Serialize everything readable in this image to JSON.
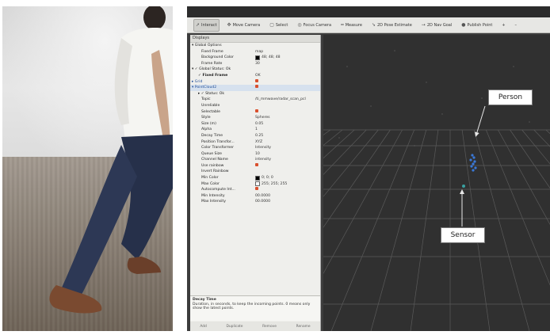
{
  "toolbar": {
    "items": [
      {
        "label": "Interact",
        "icon": "cursor-icon"
      },
      {
        "label": "Move Camera",
        "icon": "move-camera-icon"
      },
      {
        "label": "Select",
        "icon": "select-icon"
      },
      {
        "label": "Focus Camera",
        "icon": "focus-camera-icon"
      },
      {
        "label": "Measure",
        "icon": "ruler-icon"
      },
      {
        "label": "2D Pose Estimate",
        "icon": "arrow-icon"
      },
      {
        "label": "2D Nav Goal",
        "icon": "goal-icon"
      },
      {
        "label": "Publish Point",
        "icon": "pin-icon"
      },
      {
        "label": "+",
        "icon": "plus-icon"
      },
      {
        "label": "–",
        "icon": "minus-icon"
      }
    ]
  },
  "displays": {
    "header": "Displays",
    "rows": [
      {
        "key": "Global Options",
        "value": ""
      },
      {
        "key": "Fixed Frame",
        "value": "map"
      },
      {
        "key": "Background Color",
        "value": "48; 48; 48"
      },
      {
        "key": "Frame Rate",
        "value": "30"
      },
      {
        "key": "Global Status: Ok",
        "value": ""
      },
      {
        "key": "Fixed Frame",
        "value": "OK"
      },
      {
        "key": "Grid",
        "value": ""
      },
      {
        "key": "PointCloud2",
        "value": ""
      },
      {
        "key": "Status: Ok",
        "value": ""
      },
      {
        "key": "Topic",
        "value": "/ti_mmwave/radar_scan_pcl"
      },
      {
        "key": "Unreliable",
        "value": ""
      },
      {
        "key": "Selectable",
        "value": ""
      },
      {
        "key": "Style",
        "value": "Spheres"
      },
      {
        "key": "Size (m)",
        "value": "0.05"
      },
      {
        "key": "Alpha",
        "value": "1"
      },
      {
        "key": "Decay Time",
        "value": "0.25"
      },
      {
        "key": "Position Transfor...",
        "value": "XYZ"
      },
      {
        "key": "Color Transformer",
        "value": "Intensity"
      },
      {
        "key": "Queue Size",
        "value": "10"
      },
      {
        "key": "Channel Name",
        "value": "intensity"
      },
      {
        "key": "Use rainbow",
        "value": ""
      },
      {
        "key": "Invert Rainbow",
        "value": ""
      },
      {
        "key": "Min Color",
        "value": "0; 0; 0"
      },
      {
        "key": "Max Color",
        "value": "255; 255; 255"
      },
      {
        "key": "Autocompute Int...",
        "value": ""
      },
      {
        "key": "Min Intensity",
        "value": "00.0000"
      },
      {
        "key": "Max Intensity",
        "value": "00.0000"
      }
    ]
  },
  "description": {
    "title": "Decay Time",
    "text": "Duration, in seconds, to keep the incoming points. 0 means only show the latest points."
  },
  "desc_buttons": [
    "Add",
    "Duplicate",
    "Remove",
    "Rename"
  ],
  "callouts": {
    "person": "Person",
    "sensor": "Sensor"
  },
  "colors": {
    "viewport_bg": "#303030",
    "grid": "#5a5a5a",
    "points": "#3a78d8",
    "sensor_point": "#3aa0a0"
  }
}
